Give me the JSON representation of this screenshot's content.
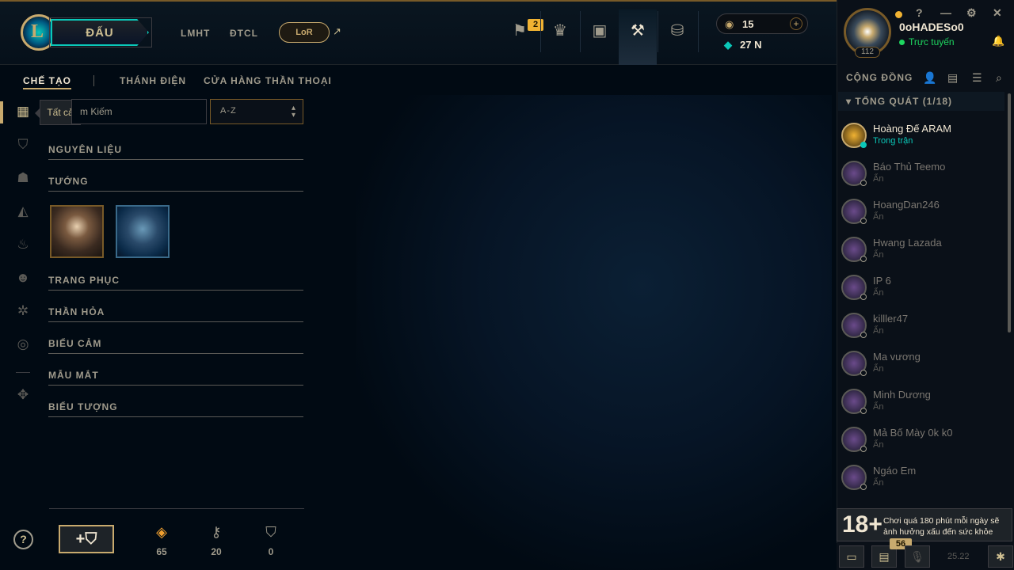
{
  "header": {
    "logo_letter": "L",
    "play_label": "ĐẤU",
    "nav": [
      "LMHT",
      "ĐTCL"
    ],
    "lor_label": "LoR",
    "missions_badge": "2",
    "rp": "15",
    "be": "27 N"
  },
  "user": {
    "name": "0oHADESo0",
    "status": "Trực tuyến",
    "level": "112"
  },
  "subnav": {
    "tabs": [
      "CHẾ TẠO",
      "THÁNH ĐIỆN",
      "CỬA HÀNG THẦN THOẠI"
    ]
  },
  "filters": {
    "tooltip": "Tất cả",
    "search_text": "m Kiếm",
    "sort_value": "A-Z"
  },
  "sections": [
    "NGUYÊN LIỆU",
    "TƯỚNG",
    "TRANG PHỤC",
    "THẦN HỎA",
    "BIỂU CẢM",
    "MẪU MẮT",
    "BIỂU TƯỢNG"
  ],
  "currencies": {
    "essence": "65",
    "keys": "20",
    "chests": "0"
  },
  "social": {
    "title": "CỘNG ĐỒNG",
    "group": "TỔNG QUÁT (1/18)",
    "friends": [
      {
        "name": "Hoàng Đế ARAM",
        "status": "Trong trận"
      },
      {
        "name": "Báo Thủ Teemo",
        "status": "Ẩn"
      },
      {
        "name": "HoangDan246",
        "status": "Ẩn"
      },
      {
        "name": "Hwang Lazada",
        "status": "Ẩn"
      },
      {
        "name": "IP 6",
        "status": "Ẩn"
      },
      {
        "name": "killler47",
        "status": "Ẩn"
      },
      {
        "name": "Ma vương",
        "status": "Ẩn"
      },
      {
        "name": "Minh Dương",
        "status": "Ẩn"
      },
      {
        "name": "Mả Bố Mày 0k k0",
        "status": "Ẩn"
      },
      {
        "name": "Ngáo Em",
        "status": "Ẩn"
      }
    ]
  },
  "warning": {
    "age": "18+",
    "text": "Chơi quá 180 phút mỗi ngày sẽ ảnh hưởng xấu đến sức khỏe"
  },
  "footer": {
    "chat_badge": "56",
    "version": "25.22"
  }
}
